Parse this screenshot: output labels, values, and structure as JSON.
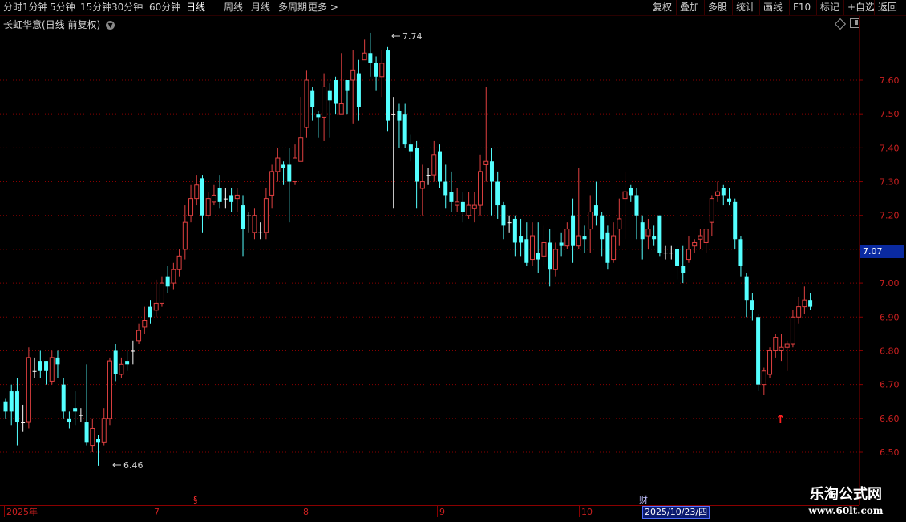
{
  "toolbar": {
    "periods": [
      "分时",
      "1分钟",
      "5分钟",
      "15分钟",
      "30分钟",
      "60分钟",
      "日线",
      "周线",
      "月线",
      "多周期",
      "更多 >"
    ],
    "active_period": "日线",
    "right_buttons": [
      "复权",
      "叠加",
      "多股",
      "统计",
      "画线",
      "F10",
      "标记",
      "+自选",
      "返回"
    ]
  },
  "stock": {
    "title": "长虹华意(日线 前复权)"
  },
  "price_axis": {
    "ticks": [
      "7.60",
      "7.50",
      "7.40",
      "7.30",
      "7.20",
      "7.10",
      "7.00",
      "6.90",
      "6.80",
      "6.70",
      "6.60",
      "6.50"
    ],
    "current": "7.07"
  },
  "annotations": {
    "high": "7.74",
    "low": "6.46",
    "up_arrow": "↑"
  },
  "date_axis": {
    "labels": [
      "2025年",
      "7",
      "8",
      "9",
      "10"
    ],
    "event_marks": [
      "§",
      "财"
    ],
    "current_date": "2025/10/23/四"
  },
  "colors": {
    "up": "#e04040",
    "down": "#54ffff",
    "grid": "#8a0000",
    "axis_text": "#cc2020"
  },
  "chart_data": {
    "type": "candlestick",
    "y_min": 6.46,
    "y_max": 7.74,
    "candles": [
      [
        6.65,
        6.62,
        6.6,
        6.66
      ],
      [
        6.68,
        6.62,
        6.58,
        6.7
      ],
      [
        6.68,
        6.59,
        6.52,
        6.72
      ],
      [
        6.59,
        6.59,
        6.56,
        6.64
      ],
      [
        6.59,
        6.78,
        6.57,
        6.81
      ],
      [
        6.74,
        6.74,
        6.72,
        6.78
      ],
      [
        6.77,
        6.74,
        6.72,
        6.8
      ],
      [
        6.77,
        6.74,
        6.7,
        6.77
      ],
      [
        6.71,
        6.78,
        6.7,
        6.8
      ],
      [
        6.78,
        6.76,
        6.72,
        6.8
      ],
      [
        6.7,
        6.62,
        6.6,
        6.72
      ],
      [
        6.6,
        6.59,
        6.57,
        6.62
      ],
      [
        6.63,
        6.62,
        6.58,
        6.68
      ],
      [
        6.61,
        6.61,
        6.59,
        6.63
      ],
      [
        6.59,
        6.53,
        6.52,
        6.76
      ],
      [
        6.52,
        6.57,
        6.5,
        6.6
      ],
      [
        6.54,
        6.53,
        6.46,
        6.55
      ],
      [
        6.53,
        6.6,
        6.52,
        6.63
      ],
      [
        6.6,
        6.77,
        6.58,
        6.78
      ],
      [
        6.8,
        6.73,
        6.71,
        6.82
      ],
      [
        6.73,
        6.76,
        6.72,
        6.78
      ],
      [
        6.77,
        6.76,
        6.74,
        6.8
      ],
      [
        6.8,
        6.8,
        6.76,
        6.83
      ],
      [
        6.83,
        6.86,
        6.82,
        6.88
      ],
      [
        6.87,
        6.89,
        6.85,
        6.93
      ],
      [
        6.93,
        6.9,
        6.88,
        6.95
      ],
      [
        6.92,
        6.94,
        6.9,
        7.01
      ],
      [
        6.94,
        7.0,
        6.93,
        7.02
      ],
      [
        7.02,
        6.99,
        6.97,
        7.05
      ],
      [
        7.0,
        7.04,
        6.98,
        7.06
      ],
      [
        7.04,
        7.08,
        7.02,
        7.1
      ],
      [
        7.1,
        7.18,
        7.07,
        7.23
      ],
      [
        7.2,
        7.25,
        7.18,
        7.29
      ],
      [
        7.25,
        7.29,
        7.23,
        7.32
      ],
      [
        7.31,
        7.2,
        7.15,
        7.32
      ],
      [
        7.2,
        7.25,
        7.19,
        7.27
      ],
      [
        7.24,
        7.26,
        7.23,
        7.29
      ],
      [
        7.28,
        7.24,
        7.22,
        7.32
      ],
      [
        7.25,
        7.25,
        7.22,
        7.28
      ],
      [
        7.26,
        7.24,
        7.21,
        7.28
      ],
      [
        7.25,
        7.26,
        7.21,
        7.28
      ],
      [
        7.23,
        7.16,
        7.08,
        7.26
      ],
      [
        7.2,
        7.2,
        7.15,
        7.21
      ],
      [
        7.15,
        7.2,
        7.13,
        7.22
      ],
      [
        7.15,
        7.15,
        7.13,
        7.18
      ],
      [
        7.15,
        7.25,
        7.13,
        7.28
      ],
      [
        7.26,
        7.33,
        7.22,
        7.35
      ],
      [
        7.33,
        7.37,
        7.3,
        7.4
      ],
      [
        7.35,
        7.34,
        7.29,
        7.36
      ],
      [
        7.35,
        7.3,
        7.18,
        7.4
      ],
      [
        7.3,
        7.37,
        7.29,
        7.41
      ],
      [
        7.36,
        7.43,
        7.36,
        7.55
      ],
      [
        7.46,
        7.6,
        7.43,
        7.63
      ],
      [
        7.57,
        7.52,
        7.48,
        7.58
      ],
      [
        7.5,
        7.49,
        7.43,
        7.51
      ],
      [
        7.49,
        7.58,
        7.42,
        7.62
      ],
      [
        7.57,
        7.54,
        7.43,
        7.59
      ],
      [
        7.6,
        7.53,
        7.5,
        7.61
      ],
      [
        7.5,
        7.53,
        7.52,
        7.68
      ],
      [
        7.6,
        7.57,
        7.5,
        7.6
      ],
      [
        7.6,
        7.63,
        7.47,
        7.69
      ],
      [
        7.62,
        7.52,
        7.48,
        7.66
      ],
      [
        7.66,
        7.68,
        7.66,
        7.72
      ],
      [
        7.68,
        7.65,
        7.61,
        7.74
      ],
      [
        7.65,
        7.61,
        7.57,
        7.67
      ],
      [
        7.61,
        7.65,
        7.55,
        7.69
      ],
      [
        7.69,
        7.48,
        7.45,
        7.7
      ],
      [
        7.5,
        7.5,
        7.22,
        7.55
      ],
      [
        7.51,
        7.48,
        7.4,
        7.53
      ],
      [
        7.5,
        7.41,
        7.4,
        7.53
      ],
      [
        7.41,
        7.39,
        7.36,
        7.44
      ],
      [
        7.4,
        7.3,
        7.22,
        7.42
      ],
      [
        7.28,
        7.3,
        7.2,
        7.35
      ],
      [
        7.32,
        7.32,
        7.29,
        7.34
      ],
      [
        7.32,
        7.38,
        7.3,
        7.42
      ],
      [
        7.39,
        7.3,
        7.28,
        7.41
      ],
      [
        7.3,
        7.26,
        7.22,
        7.35
      ],
      [
        7.27,
        7.24,
        7.21,
        7.33
      ],
      [
        7.23,
        7.24,
        7.21,
        7.28
      ],
      [
        7.24,
        7.21,
        7.18,
        7.27
      ],
      [
        7.2,
        7.23,
        7.19,
        7.27
      ],
      [
        7.22,
        7.23,
        7.18,
        7.27
      ],
      [
        7.23,
        7.33,
        7.2,
        7.38
      ],
      [
        7.35,
        7.36,
        7.3,
        7.58
      ],
      [
        7.36,
        7.3,
        7.2,
        7.4
      ],
      [
        7.3,
        7.23,
        7.19,
        7.33
      ],
      [
        7.23,
        7.17,
        7.13,
        7.24
      ],
      [
        7.18,
        7.18,
        7.15,
        7.2
      ],
      [
        7.19,
        7.12,
        7.08,
        7.2
      ],
      [
        7.14,
        7.12,
        7.08,
        7.19
      ],
      [
        7.13,
        7.06,
        7.05,
        7.18
      ],
      [
        7.07,
        7.14,
        7.05,
        7.18
      ],
      [
        7.09,
        7.07,
        7.03,
        7.18
      ],
      [
        7.08,
        7.12,
        7.05,
        7.17
      ],
      [
        7.12,
        7.04,
        6.99,
        7.16
      ],
      [
        7.04,
        7.1,
        7.02,
        7.12
      ],
      [
        7.12,
        7.11,
        7.08,
        7.15
      ],
      [
        7.11,
        7.16,
        7.1,
        7.18
      ],
      [
        7.2,
        7.11,
        7.06,
        7.25
      ],
      [
        7.11,
        7.14,
        7.1,
        7.34
      ],
      [
        7.14,
        7.13,
        7.09,
        7.17
      ],
      [
        7.16,
        7.21,
        7.09,
        7.26
      ],
      [
        7.23,
        7.2,
        7.17,
        7.3
      ],
      [
        7.2,
        7.13,
        7.08,
        7.21
      ],
      [
        7.15,
        7.06,
        7.04,
        7.17
      ],
      [
        7.07,
        7.14,
        7.06,
        7.18
      ],
      [
        7.16,
        7.19,
        7.11,
        7.25
      ],
      [
        7.25,
        7.27,
        7.13,
        7.33
      ],
      [
        7.28,
        7.26,
        7.24,
        7.29
      ],
      [
        7.26,
        7.2,
        7.13,
        7.28
      ],
      [
        7.18,
        7.13,
        7.07,
        7.2
      ],
      [
        7.14,
        7.16,
        7.1,
        7.19
      ],
      [
        7.14,
        7.13,
        7.11,
        7.17
      ],
      [
        7.2,
        7.09,
        7.08,
        7.2
      ],
      [
        7.09,
        7.09,
        7.07,
        7.11
      ],
      [
        7.09,
        7.09,
        7.07,
        7.11
      ],
      [
        7.1,
        7.05,
        7.01,
        7.11
      ],
      [
        7.05,
        7.03,
        7.0,
        7.11
      ],
      [
        7.07,
        7.1,
        7.06,
        7.14
      ],
      [
        7.11,
        7.12,
        7.09,
        7.13
      ],
      [
        7.13,
        7.14,
        7.1,
        7.16
      ],
      [
        7.12,
        7.16,
        7.09,
        7.16
      ],
      [
        7.18,
        7.25,
        7.14,
        7.26
      ],
      [
        7.26,
        7.27,
        7.24,
        7.3
      ],
      [
        7.28,
        7.26,
        7.23,
        7.29
      ],
      [
        7.25,
        7.24,
        7.23,
        7.28
      ],
      [
        7.24,
        7.13,
        7.1,
        7.25
      ],
      [
        7.13,
        7.05,
        7.02,
        7.14
      ],
      [
        7.02,
        6.95,
        6.9,
        7.03
      ],
      [
        6.95,
        6.92,
        6.89,
        6.97
      ],
      [
        6.9,
        6.7,
        6.68,
        6.91
      ],
      [
        6.7,
        6.74,
        6.67,
        6.75
      ],
      [
        6.73,
        6.8,
        6.72,
        6.81
      ],
      [
        6.8,
        6.84,
        6.78,
        6.85
      ],
      [
        6.8,
        6.81,
        6.77,
        6.85
      ],
      [
        6.81,
        6.82,
        6.74,
        6.83
      ],
      [
        6.82,
        6.9,
        6.81,
        6.92
      ],
      [
        6.9,
        6.93,
        6.88,
        6.96
      ],
      [
        6.93,
        6.95,
        6.91,
        6.99
      ],
      [
        6.95,
        6.93,
        6.92,
        6.97
      ]
    ]
  }
}
